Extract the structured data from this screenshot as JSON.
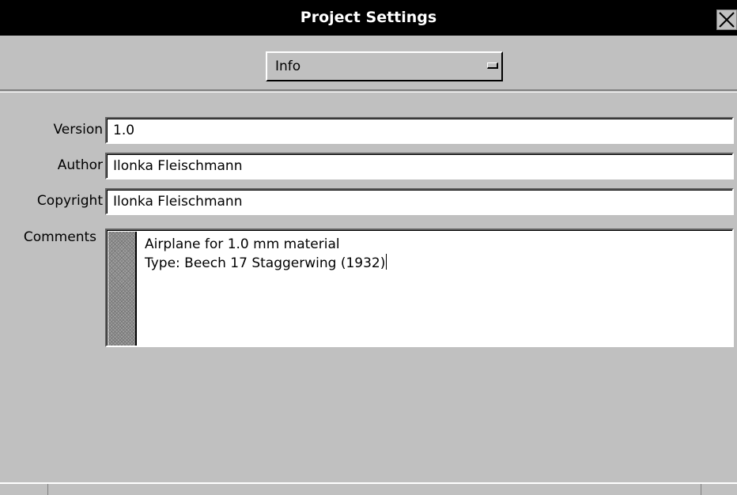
{
  "window": {
    "title": "Project Settings"
  },
  "page_selector": {
    "selected": "Info"
  },
  "fields": {
    "version": {
      "label": "Version",
      "value": "1.0"
    },
    "author": {
      "label": "Author",
      "value": "Ilonka Fleischmann"
    },
    "copyright": {
      "label": "Copyright",
      "value": "Ilonka Fleischmann"
    },
    "comments": {
      "label": "Comments",
      "lines": [
        "Airplane for 1.0 mm material",
        "Type: Beech 17 Staggerwing (1932)"
      ]
    }
  },
  "icons": {
    "close": "close-icon",
    "option_menu": "option-menu-indicator-icon"
  }
}
